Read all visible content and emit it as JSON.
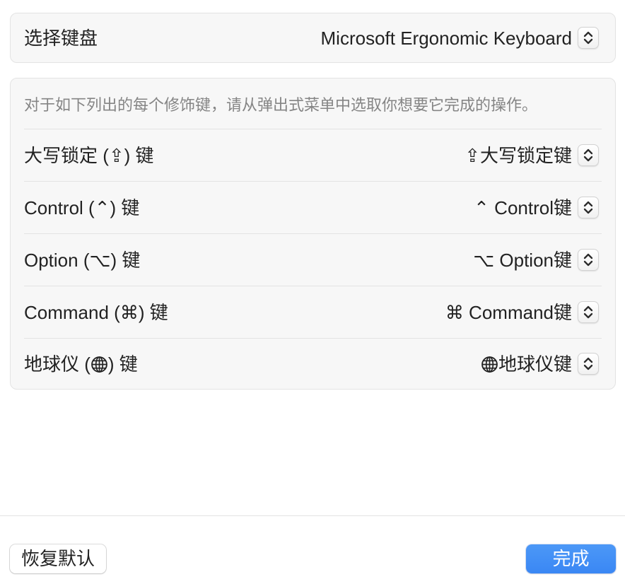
{
  "keyboard_select": {
    "label": "选择键盘",
    "value": "Microsoft Ergonomic Keyboard"
  },
  "modifiers": {
    "description": "对于如下列出的每个修饰键，请从弹出式菜单中选取你想要它完成的操作。",
    "rows": [
      {
        "label": "大写锁定 (⇪) 键",
        "value": "⇪大写锁定键"
      },
      {
        "label": "Control (⌃) 键",
        "value": "⌃ Control键"
      },
      {
        "label": "Option (⌥) 键",
        "value": "⌥ Option键"
      },
      {
        "label": "Command (⌘) 键",
        "value": "⌘ Command键"
      },
      {
        "label_before": "地球仪 (",
        "label_icon": "globe-icon",
        "label_after": ") 键",
        "value_icon": "globe-icon",
        "value": "地球仪键"
      }
    ]
  },
  "footer": {
    "restore_defaults_label": "恢复默认",
    "done_label": "完成"
  },
  "icons": {
    "popup_indicator": "up-down-chevrons-icon",
    "globe": "globe-icon"
  },
  "colors": {
    "accent": "#3a87f4",
    "card_background": "#f7f7f7",
    "secondary_text": "#858585"
  }
}
